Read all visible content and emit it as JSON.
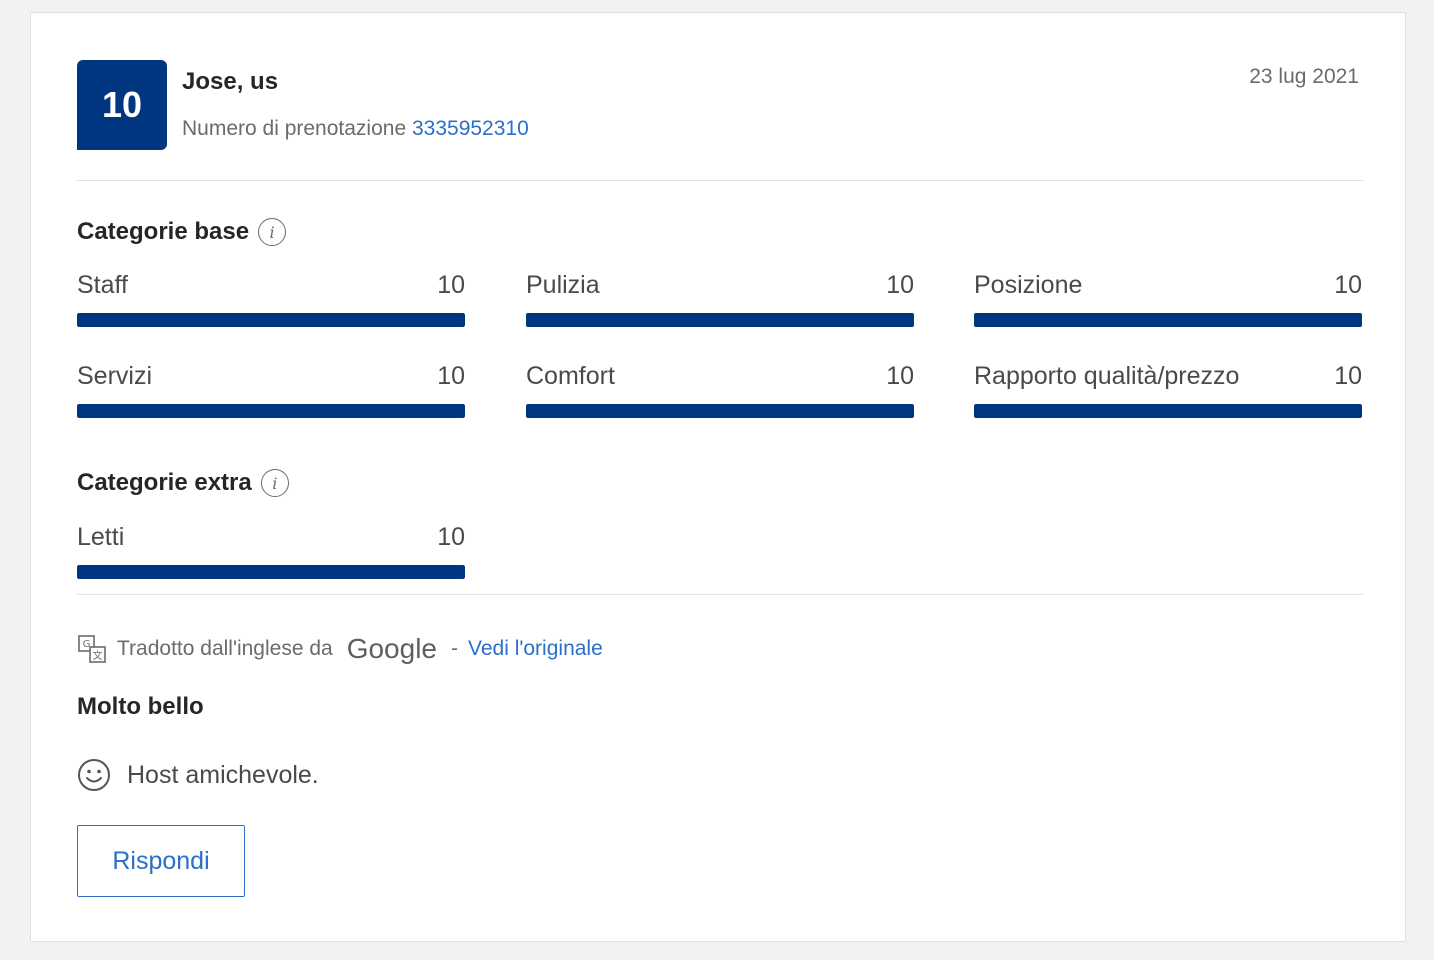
{
  "review": {
    "score": "10",
    "reviewer": "Jose, us",
    "booking_label": "Numero di prenotazione",
    "booking_number": "3335952310",
    "date": "23 lug 2021"
  },
  "base_categories": {
    "title": "Categorie base",
    "info_icon": "info-icon",
    "items": [
      {
        "label": "Staff",
        "value": "10",
        "fill": 1.0
      },
      {
        "label": "Pulizia",
        "value": "10",
        "fill": 1.0
      },
      {
        "label": "Posizione",
        "value": "10",
        "fill": 1.0
      },
      {
        "label": "Servizi",
        "value": "10",
        "fill": 1.0
      },
      {
        "label": "Comfort",
        "value": "10",
        "fill": 1.0
      },
      {
        "label": "Rapporto qualità/prezzo",
        "value": "10",
        "fill": 1.0
      }
    ]
  },
  "extra_categories": {
    "title": "Categorie extra",
    "info_icon": "info-icon",
    "items": [
      {
        "label": "Letti",
        "value": "10",
        "fill": 1.0
      }
    ]
  },
  "translation": {
    "text": "Tradotto dall'inglese da",
    "provider": "Google",
    "separator": "-",
    "link": "Vedi l'originale",
    "icon": "translate-icon"
  },
  "content": {
    "title": "Molto bello",
    "positive": "Host amichevole.",
    "positive_icon": "smile-icon"
  },
  "actions": {
    "reply": "Rispondi"
  },
  "colors": {
    "brand": "#003580",
    "link": "#2a6fc9"
  }
}
